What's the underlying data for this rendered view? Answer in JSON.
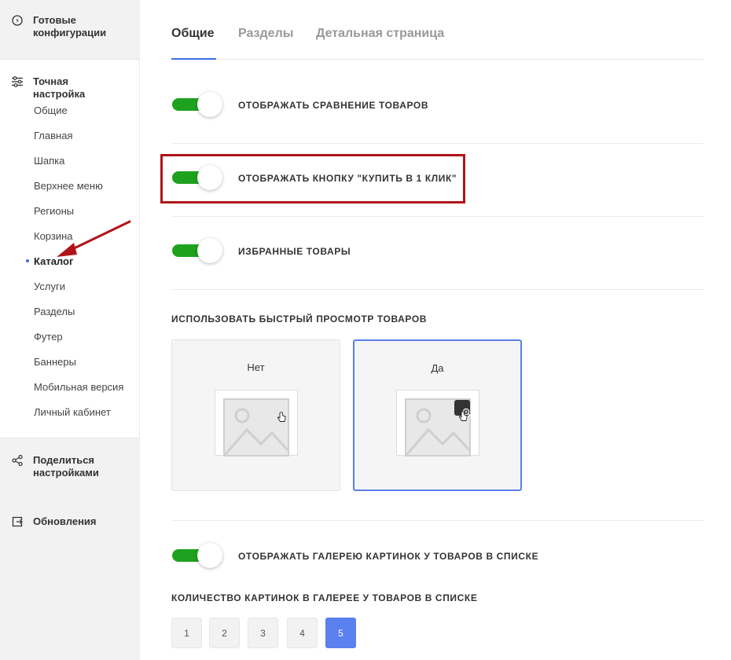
{
  "sidebar": {
    "ready_configs": "Готовые конфигурации",
    "fine_tuning": "Точная настройка",
    "items": [
      {
        "label": "Общие"
      },
      {
        "label": "Главная"
      },
      {
        "label": "Шапка"
      },
      {
        "label": "Верхнее меню"
      },
      {
        "label": "Регионы"
      },
      {
        "label": "Корзина"
      },
      {
        "label": "Каталог"
      },
      {
        "label": "Услуги"
      },
      {
        "label": "Разделы"
      },
      {
        "label": "Футер"
      },
      {
        "label": "Баннеры"
      },
      {
        "label": "Мобильная версия"
      },
      {
        "label": "Личный кабинет"
      }
    ],
    "active_item": "Каталог",
    "share": "Поделиться настройками",
    "updates": "Обновления"
  },
  "tabs": [
    {
      "label": "Общие",
      "active": true
    },
    {
      "label": "Разделы",
      "active": false
    },
    {
      "label": "Детальная страница",
      "active": false
    }
  ],
  "toggles": [
    {
      "label": "Отображать сравнение товаров",
      "on": true
    },
    {
      "label": "Отображать кнопку \"Купить в 1 клик\"",
      "on": true
    },
    {
      "label": "Избранные товары",
      "on": true
    },
    {
      "label": "Отображать галерею картинок у товаров в списке",
      "on": true
    }
  ],
  "quick_view": {
    "title": "Использовать быстрый просмотр товаров",
    "options": [
      {
        "label": "Нет",
        "selected": false
      },
      {
        "label": "Да",
        "selected": true
      }
    ]
  },
  "gallery_count": {
    "title": "Количество картинок в галерее у товаров в списке",
    "options": [
      "1",
      "2",
      "3",
      "4",
      "5"
    ],
    "selected": "5"
  },
  "colors": {
    "accent": "#3e6ee5",
    "toggle_on": "#1ea11e",
    "highlight": "#b0141a",
    "selected_button": "#5b80f0"
  }
}
